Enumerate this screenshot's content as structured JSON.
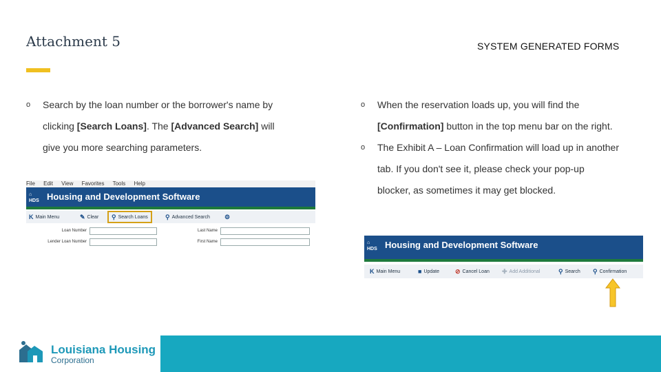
{
  "slide": {
    "title": "Attachment 5",
    "heading": "SYSTEM GENERATED FORMS",
    "accent_color": "#f0c020",
    "footer_color": "#17a8c0"
  },
  "left_bullet": {
    "marker": "o",
    "line1": "Search by the loan number or the borrower's name by",
    "line2_pre": "clicking ",
    "line2_b1": "[Search Loans]",
    "line2_mid": ". The ",
    "line2_b2": "[Advanced Search]",
    "line2_post": " will",
    "line3": "give you more searching parameters."
  },
  "right_bullet_1": {
    "marker": "o",
    "line1": "When the reservation loads up, you will find the",
    "line2_b": "[Confirmation]",
    "line2_post": " button in the top menu bar on the right."
  },
  "right_bullet_2": {
    "marker": "o",
    "line1": "The Exhibit A – Loan Confirmation will load up in another",
    "line2": "tab. If you don't see it, please check your pop-up",
    "line3": "blocker, as sometimes it may get blocked."
  },
  "screenshot_1": {
    "menu": [
      "File",
      "Edit",
      "View",
      "Favorites",
      "Tools",
      "Help"
    ],
    "logo_text": "HDS",
    "banner_title": "Housing and Development Software",
    "toolbar": [
      "Main Menu",
      "Clear",
      "Search Loans",
      "Advanced Search"
    ],
    "fields": [
      "Loan Number",
      "Lender Loan Number",
      "Last Name",
      "First Name"
    ]
  },
  "screenshot_2": {
    "logo_text": "HDS",
    "banner_title": "Housing and Development Software",
    "toolbar": [
      "Main Menu",
      "Update",
      "Cancel Loan",
      "Add Additional",
      "Search",
      "Confirmation"
    ]
  },
  "footer": {
    "org_line1": "Louisiana Housing",
    "org_line2": "Corporation"
  }
}
